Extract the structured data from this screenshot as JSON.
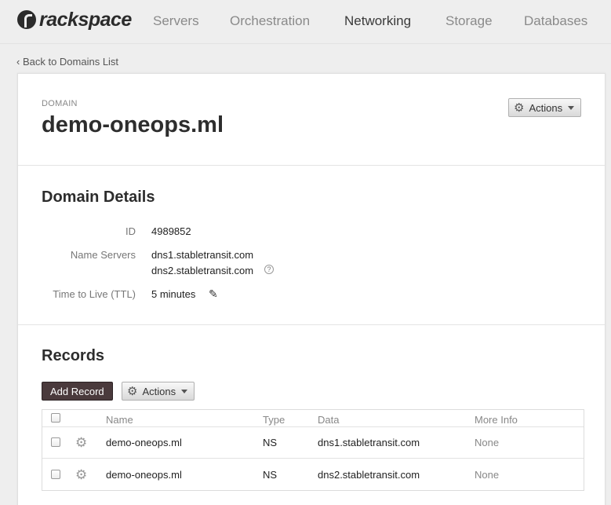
{
  "brand": {
    "name": "rackspace"
  },
  "nav": {
    "items": [
      {
        "label": "Servers"
      },
      {
        "label": "Orchestration"
      },
      {
        "label": "Networking"
      },
      {
        "label": "Storage"
      },
      {
        "label": "Databases"
      }
    ],
    "active": "Networking"
  },
  "back_link": "‹ Back to Domains List",
  "domain": {
    "eyebrow": "DOMAIN",
    "name": "demo-oneops.ml",
    "actions_label": "Actions"
  },
  "details": {
    "title": "Domain Details",
    "id_label": "ID",
    "id_value": "4989852",
    "ns_label": "Name Servers",
    "ns_values": [
      "dns1.stabletransit.com",
      "dns2.stabletransit.com"
    ],
    "ttl_label": "Time to Live (TTL)",
    "ttl_value": "5 minutes"
  },
  "records": {
    "title": "Records",
    "add_label": "Add Record",
    "actions_label": "Actions",
    "columns": [
      "Name",
      "Type",
      "Data",
      "More Info"
    ],
    "rows": [
      {
        "name": "demo-oneops.ml",
        "type": "NS",
        "data": "dns1.stabletransit.com",
        "more_info": "None"
      },
      {
        "name": "demo-oneops.ml",
        "type": "NS",
        "data": "dns2.stabletransit.com",
        "more_info": "None"
      }
    ]
  },
  "icons": {
    "gear": "gear-icon",
    "caret": "caret-down-icon",
    "help": "help-icon",
    "edit": "pencil-icon"
  },
  "colors": {
    "primary_button": "#4a3a3c",
    "background": "#eeeeee",
    "card": "#ffffff"
  }
}
